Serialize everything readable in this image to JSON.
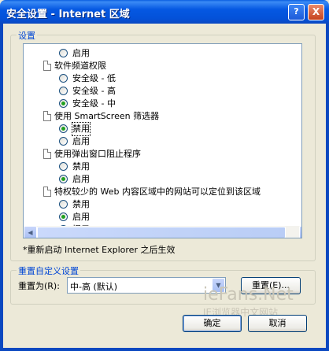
{
  "window": {
    "title": "安全设置 - Internet 区域",
    "help_label": "?",
    "close_label": "X"
  },
  "settings_group": {
    "label": "设置"
  },
  "tree_items": [
    {
      "kind": "radio",
      "label": "启用",
      "selected": false
    },
    {
      "kind": "doc",
      "label": "软件频道权限"
    },
    {
      "kind": "radio",
      "label": "安全级 - 低",
      "selected": false
    },
    {
      "kind": "radio",
      "label": "安全级 - 高",
      "selected": false
    },
    {
      "kind": "radio",
      "label": "安全级 - 中",
      "selected": true
    },
    {
      "kind": "doc",
      "label": "使用 SmartScreen 筛选器"
    },
    {
      "kind": "radio",
      "label": "禁用",
      "selected": true
    },
    {
      "kind": "radio",
      "label": "启用",
      "selected": false
    },
    {
      "kind": "doc",
      "label": "使用弹出窗口阻止程序"
    },
    {
      "kind": "radio",
      "label": "禁用",
      "selected": false
    },
    {
      "kind": "radio",
      "label": "启用",
      "selected": true
    },
    {
      "kind": "doc",
      "label": "特权较少的 Web 内容区域中的网站可以定位到该区域"
    },
    {
      "kind": "radio",
      "label": "禁用",
      "selected": false
    },
    {
      "kind": "radio",
      "label": "启用",
      "selected": true
    },
    {
      "kind": "radio",
      "label": "提示",
      "selected": false
    }
  ],
  "restart_note": "*重新启动 Internet Explorer 之后生效",
  "reset_group": {
    "label": "重置自定义设置",
    "reset_to_label": "重置为(R):",
    "selected_level": "中-高 (默认)",
    "reset_button": "重置(E)..."
  },
  "buttons": {
    "ok": "确定",
    "cancel": "取消"
  },
  "watermark": {
    "line1": "ieFans.Net",
    "line2": "IE浏览器中文网站"
  }
}
